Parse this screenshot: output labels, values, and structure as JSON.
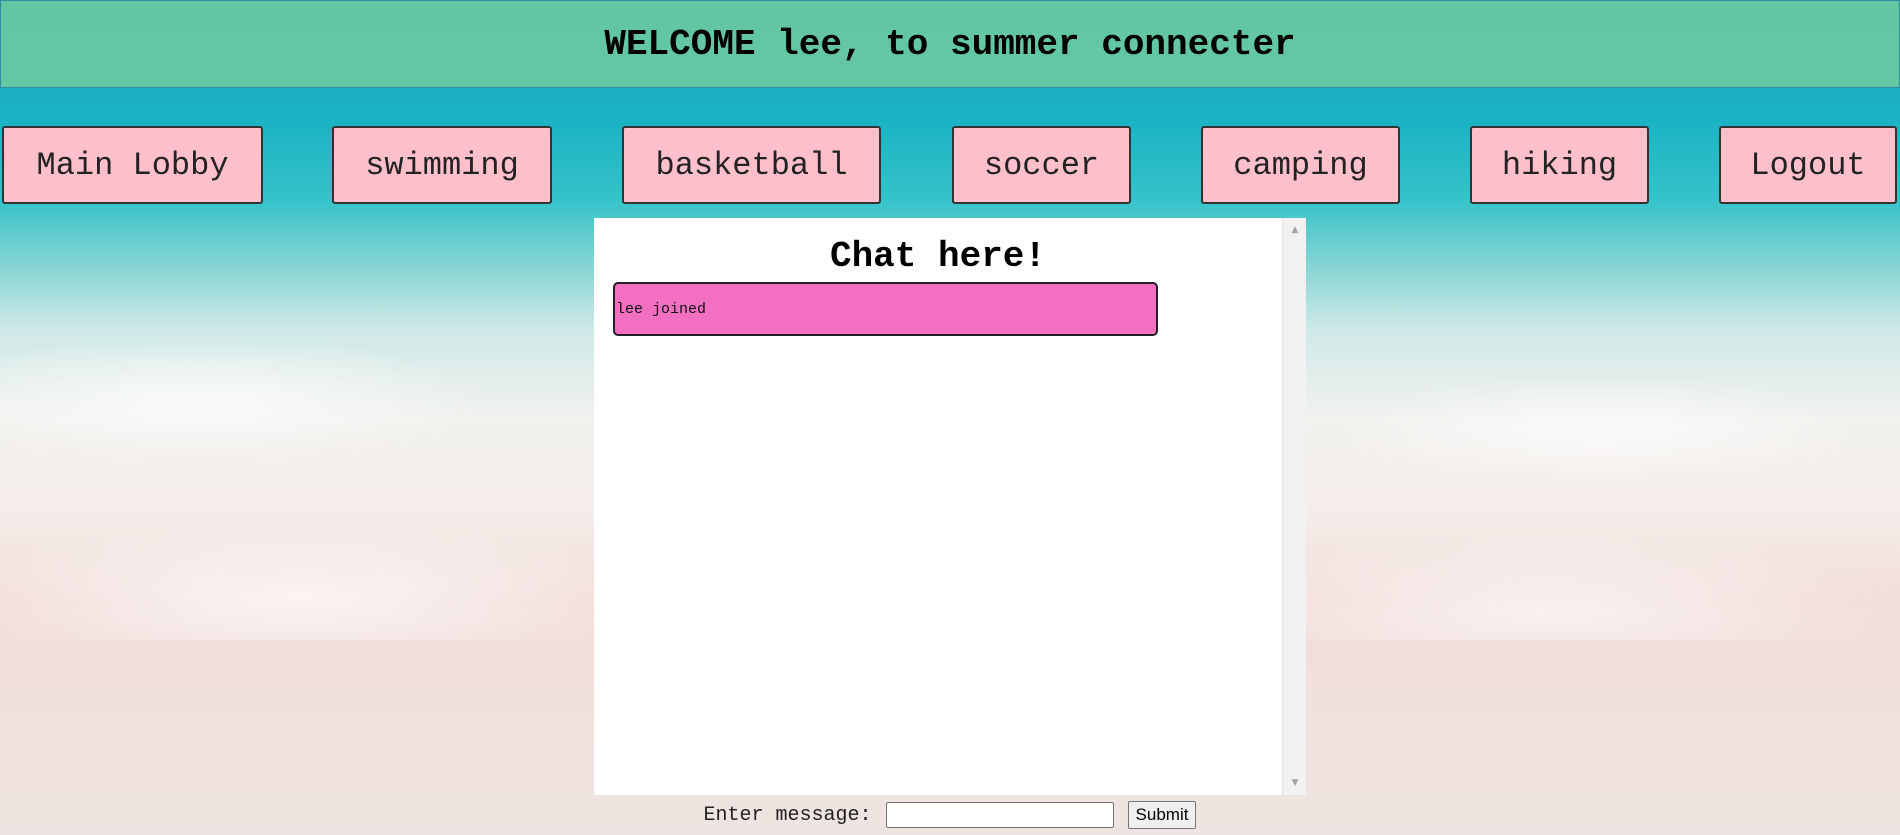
{
  "header": {
    "title": "WELCOME lee, to summer connecter"
  },
  "nav": {
    "items": [
      {
        "label": "Main Lobby"
      },
      {
        "label": "swimming"
      },
      {
        "label": "basketball"
      },
      {
        "label": "soccer"
      },
      {
        "label": "camping"
      },
      {
        "label": "hiking"
      },
      {
        "label": "Logout"
      }
    ]
  },
  "chat": {
    "title": "Chat here!",
    "messages": [
      {
        "text": "lee joined"
      }
    ]
  },
  "form": {
    "label": "Enter message:",
    "input_value": "",
    "input_placeholder": "",
    "submit_label": "Submit"
  },
  "colors": {
    "header_bg": "#66c8a0",
    "nav_button_bg": "#ffc0cb",
    "message_bg": "#f26fc2",
    "chat_panel_bg": "#ffffff"
  },
  "icons": {
    "scroll_up": "scroll-up-arrow-icon",
    "scroll_down": "scroll-down-arrow-icon"
  }
}
